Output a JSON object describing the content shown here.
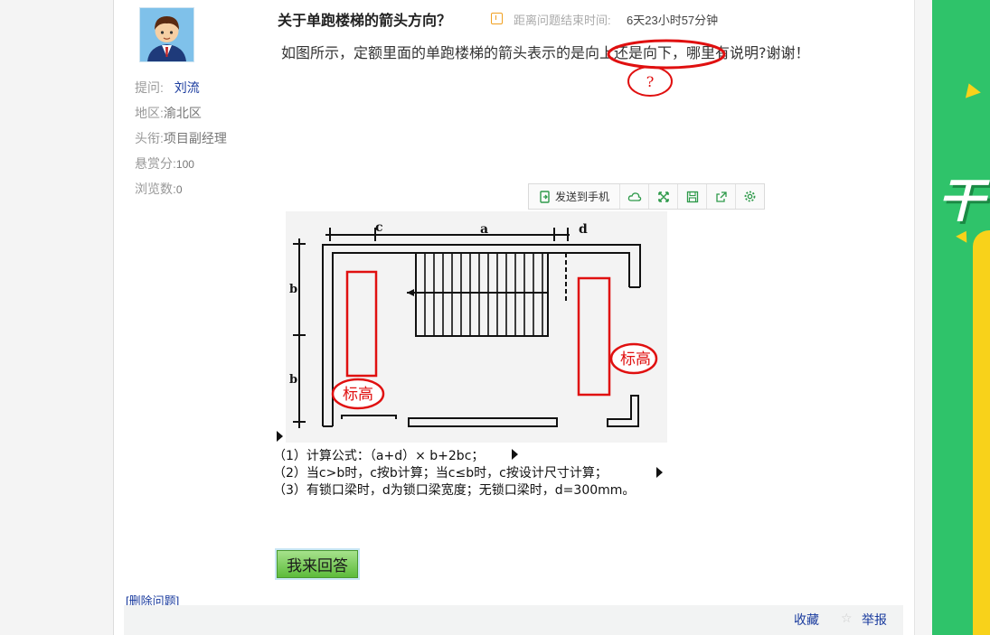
{
  "question": {
    "title": "关于单跑楼梯的箭头方向？",
    "timer_label": "距离问题结束时间:",
    "timer_value": "6天23小时57分钟",
    "body": "如图所示，定额里面的单跑楼梯的箭头表示的是向上还是向下，哪里有说明?谢谢！",
    "highlight_mark": "?"
  },
  "asker": {
    "ask_label": "提问:",
    "name": "刘流",
    "region_label": "地区:",
    "region": "渝北区",
    "title_label": "头衔:",
    "title": "项目副经理",
    "reward_label": "悬赏分:",
    "reward": "100",
    "views_label": "浏览数:",
    "views": "0"
  },
  "toolbar": {
    "send_label": "发送到手机",
    "icons": [
      "send-to-phone-icon",
      "cloud-icon",
      "fullscreen-icon",
      "save-icon",
      "share-icon",
      "settings-icon"
    ]
  },
  "figure": {
    "dim_c": "c",
    "dim_a": "a",
    "dim_d": "d",
    "dim_b1": "b",
    "dim_b2": "b",
    "mark_left": "标高",
    "mark_right": "标高",
    "lines": [
      "（1）计算公式：（a+d）× b+2bc；",
      "（2）当c>b时，c按b计算；当c≤b时，c按设计尺寸计算；",
      "（3）有锁口梁时，d为锁口梁宽度；无锁口梁时，d=300mm。"
    ]
  },
  "actions": {
    "answer_button": "我来回答",
    "delete_link": "[删除问题]",
    "favorite": "收藏",
    "report": "举报"
  },
  "colors": {
    "accent_green": "#5dbb3b",
    "link_blue": "#1a3b9e",
    "annotation_red": "#e01010",
    "ad_green": "#2fc36a"
  }
}
